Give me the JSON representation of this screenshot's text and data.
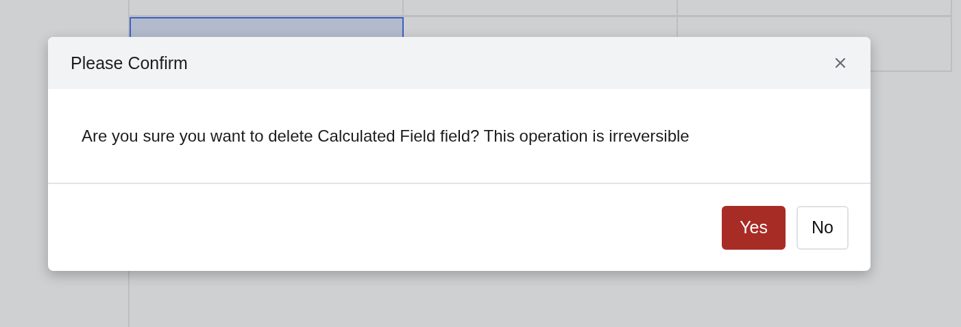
{
  "table": {
    "rows": [
      {
        "cells": [
          {
            "selected": false
          },
          {
            "selected": false
          },
          {
            "selected": false
          }
        ]
      },
      {
        "cells": [
          {
            "selected": true
          },
          {
            "selected": false
          },
          {
            "selected": false
          }
        ]
      }
    ]
  },
  "dialog": {
    "title": "Please Confirm",
    "message": "Are you sure you want to delete Calculated Field field? This operation is irreversible",
    "buttons": [
      {
        "label": "Yes",
        "kind": "primary"
      },
      {
        "label": "No",
        "kind": "secondary"
      }
    ]
  }
}
